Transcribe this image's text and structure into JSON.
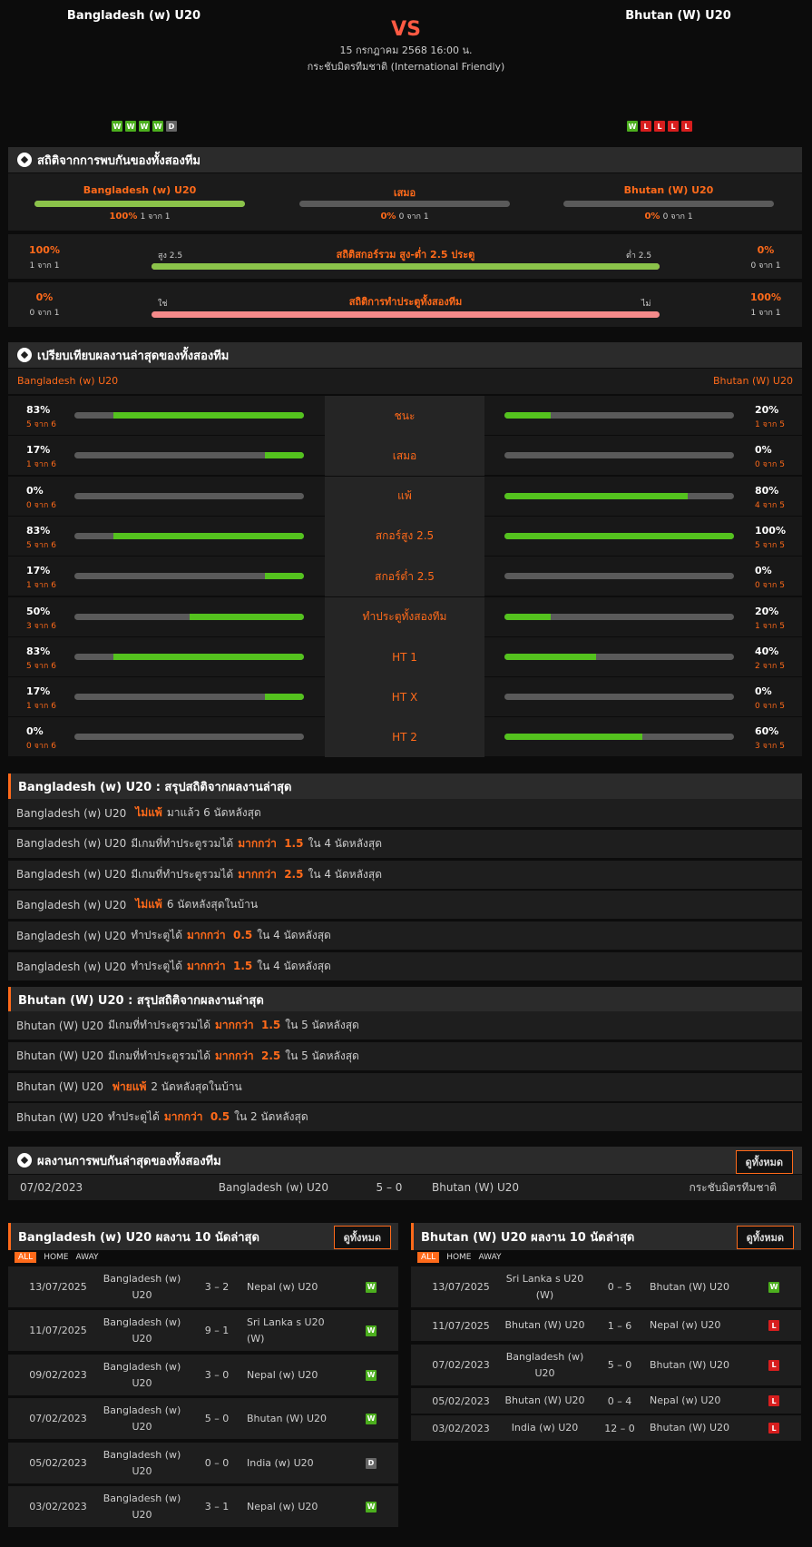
{
  "match": {
    "home": "Bangladesh (w) U20",
    "away": "Bhutan (W) U20",
    "vs": "VS",
    "datetime": "15 กรกฎาคม 2568 16:00 น.",
    "competition": "กระชับมิตรทีมชาติ (International Friendly)",
    "home_form": [
      "W",
      "W",
      "W",
      "W",
      "D"
    ],
    "away_form": [
      "W",
      "L",
      "L",
      "L",
      "L"
    ]
  },
  "h2h_stats": {
    "title": "สถิติจากการพบกันของทั้งสองทีม",
    "home": {
      "label": "Bangladesh (w) U20",
      "pct": "100%",
      "sub": "1 จาก 1",
      "level": 1
    },
    "draw": {
      "label": "เสมอ",
      "pct": "0%",
      "sub": "0 จาก 1",
      "level": 0
    },
    "away": {
      "label": "Bhutan (W) U20",
      "pct": "0%",
      "sub": "0 จาก 1",
      "level": 0
    },
    "ou": {
      "title": "สถิติสกอร์รวม สูง-ต่ำ 2.5 ประตู",
      "left_label": "สูง 2.5",
      "right_label": "ต่ำ 2.5",
      "left_pct": "100%",
      "left_sub": "1 จาก 1",
      "right_pct": "0%",
      "right_sub": "0 จาก 1"
    },
    "btts": {
      "title": "สถิติการทำประตูทั้งสองทีม",
      "left_label": "ใช่",
      "right_label": "ไม่",
      "left_pct": "0%",
      "left_sub": "0 จาก 1",
      "right_pct": "100%",
      "right_sub": "1 จาก 1"
    }
  },
  "compare": {
    "title": "เปรียบเทียบผลงานล่าสุดของทั้งสองทีม",
    "home": "Bangladesh (w) U20",
    "away": "Bhutan (W) U20",
    "rows": [
      {
        "label": "ชนะ",
        "hp": "83%",
        "hs": "5 จาก 6",
        "hv": 0.83,
        "ap": "20%",
        "as": "1 จาก 5",
        "av": 0.2
      },
      {
        "label": "เสมอ",
        "hp": "17%",
        "hs": "1 จาก 6",
        "hv": 0.17,
        "ap": "0%",
        "as": "0 จาก 5",
        "av": 0
      },
      {
        "label": "แพ้",
        "hp": "0%",
        "hs": "0 จาก 6",
        "hv": 0,
        "ap": "80%",
        "as": "4 จาก 5",
        "av": 0.8
      },
      {
        "label": "สกอร์สูง 2.5",
        "hp": "83%",
        "hs": "5 จาก 6",
        "hv": 0.83,
        "ap": "100%",
        "as": "5 จาก 5",
        "av": 1
      },
      {
        "label": "สกอร์ต่ำ 2.5",
        "hp": "17%",
        "hs": "1 จาก 6",
        "hv": 0.17,
        "ap": "0%",
        "as": "0 จาก 5",
        "av": 0
      },
      {
        "label": "ทำประตูทั้งสองทีม",
        "hp": "50%",
        "hs": "3 จาก 6",
        "hv": 0.5,
        "ap": "20%",
        "as": "1 จาก 5",
        "av": 0.2
      },
      {
        "label": "HT 1",
        "hp": "83%",
        "hs": "5 จาก 6",
        "hv": 0.83,
        "ap": "40%",
        "as": "2 จาก 5",
        "av": 0.4
      },
      {
        "label": "HT X",
        "hp": "17%",
        "hs": "1 จาก 6",
        "hv": 0.17,
        "ap": "0%",
        "as": "0 จาก 5",
        "av": 0
      },
      {
        "label": "HT 2",
        "hp": "0%",
        "hs": "0 จาก 6",
        "hv": 0,
        "ap": "60%",
        "as": "3 จาก 5",
        "av": 0.6
      }
    ]
  },
  "home_summary": {
    "title": "Bangladesh (w) U20 : สรุปสถิติจากผลงานล่าสุด",
    "rows": [
      {
        "a": "Bangladesh (w) U20",
        "b": "",
        "hl": "ไม่แพ้",
        "c": "มาแล้ว 6 นัดหลังสุด"
      },
      {
        "a": "Bangladesh (w) U20",
        "b": "มีเกมที่ทำประตูรวมได้",
        "hl": "มากกว่า  1.5",
        "c": "ใน 4 นัดหลังสุด"
      },
      {
        "a": "Bangladesh (w) U20",
        "b": "มีเกมที่ทำประตูรวมได้",
        "hl": "มากกว่า  2.5",
        "c": "ใน 4 นัดหลังสุด"
      },
      {
        "a": "Bangladesh (w) U20",
        "b": "",
        "hl": "ไม่แพ้",
        "c": "6  นัดหลังสุดในบ้าน"
      },
      {
        "a": "Bangladesh (w) U20",
        "b": "ทำประตูได้",
        "hl": "มากกว่า  0.5",
        "c": "ใน 4 นัดหลังสุด"
      },
      {
        "a": "Bangladesh (w) U20",
        "b": "ทำประตูได้",
        "hl": "มากกว่า  1.5",
        "c": "ใน 4 นัดหลังสุด"
      }
    ]
  },
  "away_summary": {
    "title": "Bhutan (W) U20 : สรุปสถิติจากผลงานล่าสุด",
    "rows": [
      {
        "a": "Bhutan (W) U20",
        "b": "มีเกมที่ทำประตูรวมได้",
        "hl": "มากกว่า  1.5",
        "c": "ใน 5 นัดหลังสุด"
      },
      {
        "a": "Bhutan (W) U20",
        "b": "มีเกมที่ทำประตูรวมได้",
        "hl": "มากกว่า  2.5",
        "c": "ใน 5 นัดหลังสุด"
      },
      {
        "a": "Bhutan (W) U20",
        "b": "",
        "hl": "พ่ายแพ้",
        "c": "2  นัดหลังสุดในบ้าน"
      },
      {
        "a": "Bhutan (W) U20",
        "b": "ทำประตูได้",
        "hl": "มากกว่า  0.5",
        "c": "ใน 2 นัดหลังสุด"
      }
    ]
  },
  "h2h_results": {
    "title": "ผลงานการพบกันล่าสุดของทั้งสองทีม",
    "button": "ดูทั้งหมด",
    "rows": [
      {
        "date": "07/02/2023",
        "home": "Bangladesh (w) U20",
        "score": "5 – 0",
        "away": "Bhutan (W) U20",
        "comp": "กระชับมิตรทีมชาติ"
      }
    ]
  },
  "home_last10": {
    "title": "Bangladesh (w) U20 ผลงาน 10 นัดล่าสุด",
    "button": "ดูทั้งหมด",
    "tabs": [
      "ALL",
      "HOME",
      "AWAY"
    ],
    "rows": [
      {
        "date": "13/07/2025",
        "home": "Bangladesh (w) U20",
        "score": "3 – 2",
        "away": "Nepal (w) U20",
        "res": "W"
      },
      {
        "date": "11/07/2025",
        "home": "Bangladesh (w) U20",
        "score": "9 – 1",
        "away": "Sri Lanka s U20 (W)",
        "res": "W"
      },
      {
        "date": "09/02/2023",
        "home": "Bangladesh (w) U20",
        "score": "3 – 0",
        "away": "Nepal (w) U20",
        "res": "W"
      },
      {
        "date": "07/02/2023",
        "home": "Bangladesh (w) U20",
        "score": "5 – 0",
        "away": "Bhutan (W) U20",
        "res": "W"
      },
      {
        "date": "05/02/2023",
        "home": "Bangladesh (w) U20",
        "score": "0 – 0",
        "away": "India (w) U20",
        "res": "D"
      },
      {
        "date": "03/02/2023",
        "home": "Bangladesh (w) U20",
        "score": "3 – 1",
        "away": "Nepal (w) U20",
        "res": "W"
      }
    ]
  },
  "away_last10": {
    "title": "Bhutan (W) U20 ผลงาน 10 นัดล่าสุด",
    "button": "ดูทั้งหมด",
    "tabs": [
      "ALL",
      "HOME",
      "AWAY"
    ],
    "rows": [
      {
        "date": "13/07/2025",
        "home": "Sri Lanka s U20 (W)",
        "score": "0 – 5",
        "away": "Bhutan (W) U20",
        "res": "W"
      },
      {
        "date": "11/07/2025",
        "home": "Bhutan (W) U20",
        "score": "1 – 6",
        "away": "Nepal (w) U20",
        "res": "L"
      },
      {
        "date": "07/02/2023",
        "home": "Bangladesh (w) U20",
        "score": "5 – 0",
        "away": "Bhutan (W) U20",
        "res": "L"
      },
      {
        "date": "05/02/2023",
        "home": "Bhutan (W) U20",
        "score": "0 – 4",
        "away": "Nepal (w) U20",
        "res": "L"
      },
      {
        "date": "03/02/2023",
        "home": "India (w) U20",
        "score": "12 – 0",
        "away": "Bhutan (W) U20",
        "res": "L"
      }
    ]
  }
}
